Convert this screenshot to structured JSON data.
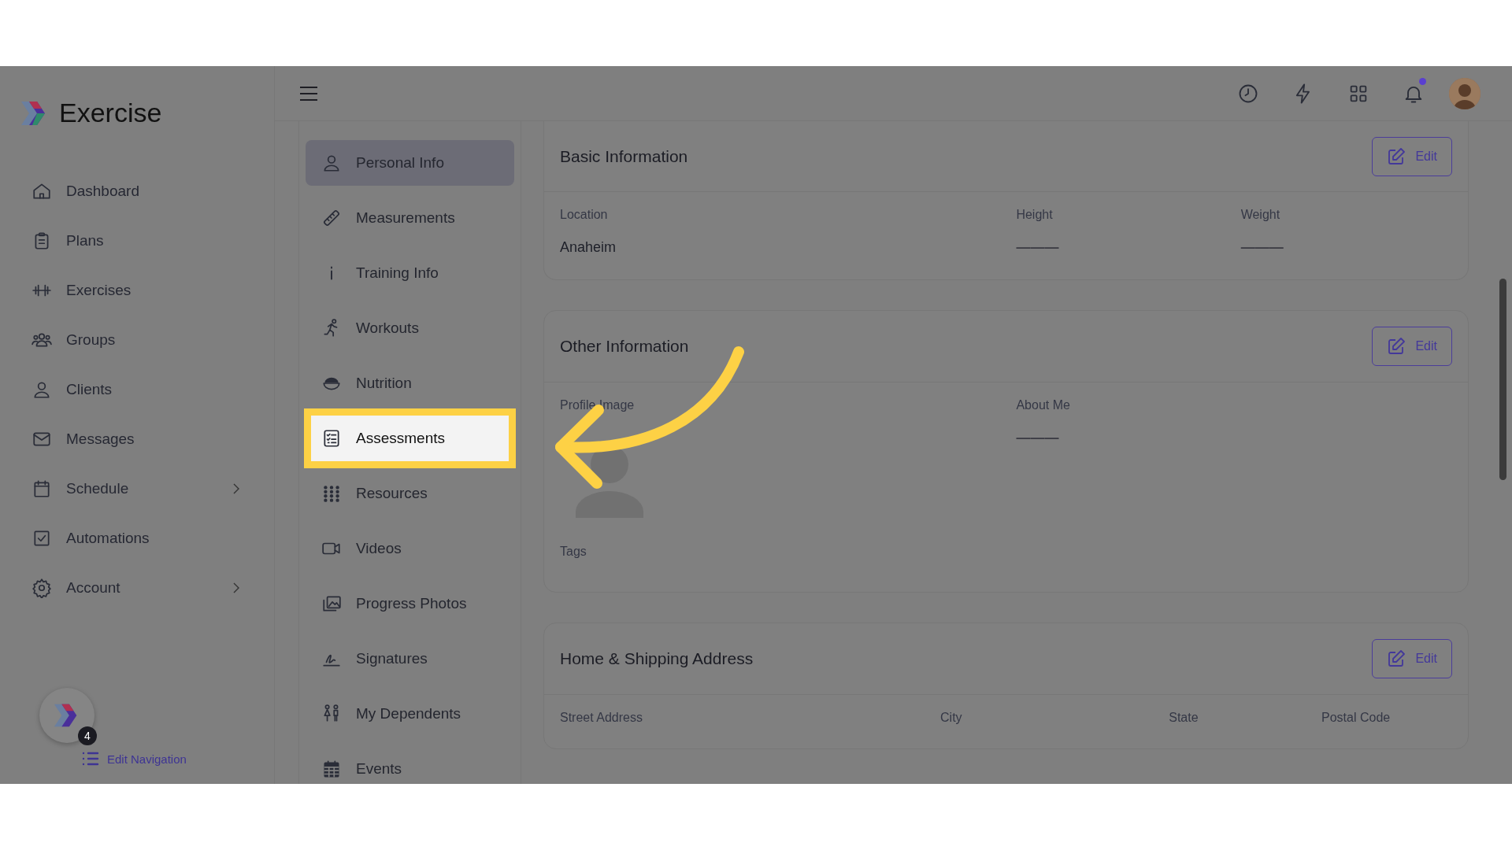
{
  "brand": {
    "name": "Exercise"
  },
  "sidebar": {
    "items": [
      {
        "label": "Dashboard",
        "expandable": false
      },
      {
        "label": "Plans",
        "expandable": false
      },
      {
        "label": "Exercises",
        "expandable": false
      },
      {
        "label": "Groups",
        "expandable": false
      },
      {
        "label": "Clients",
        "expandable": false
      },
      {
        "label": "Messages",
        "expandable": false
      },
      {
        "label": "Schedule",
        "expandable": true
      },
      {
        "label": "Automations",
        "expandable": false
      },
      {
        "label": "Account",
        "expandable": true
      }
    ],
    "badge": "4",
    "edit_navigation": "Edit Navigation"
  },
  "submenu": {
    "items": [
      {
        "label": "Personal Info",
        "selected": true,
        "highlighted": false
      },
      {
        "label": "Measurements",
        "selected": false,
        "highlighted": false
      },
      {
        "label": "Training Info",
        "selected": false,
        "highlighted": false
      },
      {
        "label": "Workouts",
        "selected": false,
        "highlighted": false
      },
      {
        "label": "Nutrition",
        "selected": false,
        "highlighted": false
      },
      {
        "label": "Assessments",
        "selected": false,
        "highlighted": true
      },
      {
        "label": "Resources",
        "selected": false,
        "highlighted": false
      },
      {
        "label": "Videos",
        "selected": false,
        "highlighted": false
      },
      {
        "label": "Progress Photos",
        "selected": false,
        "highlighted": false
      },
      {
        "label": "Signatures",
        "selected": false,
        "highlighted": false
      },
      {
        "label": "My Dependents",
        "selected": false,
        "highlighted": false
      },
      {
        "label": "Events",
        "selected": false,
        "highlighted": false
      }
    ]
  },
  "topbar": {
    "notification_unread": true
  },
  "cards": [
    {
      "title": "Basic Information",
      "button": "Edit",
      "fields": [
        {
          "label": "Location",
          "value": "Anaheim"
        },
        {
          "label": "Height",
          "value": "———"
        },
        {
          "label": "Weight",
          "value": "———"
        }
      ]
    },
    {
      "title": "Other Information",
      "button": "Edit",
      "fields": [
        {
          "label": "Profile Image",
          "kind": "image"
        },
        {
          "label": "About Me",
          "value": "———"
        },
        {
          "label": "Tags",
          "kind": "tags"
        }
      ]
    },
    {
      "title": "Home & Shipping Address",
      "button": "Edit",
      "fields": [
        {
          "label": "Street Address"
        },
        {
          "label": "City"
        },
        {
          "label": "State"
        },
        {
          "label": "Postal Code"
        }
      ]
    }
  ]
}
